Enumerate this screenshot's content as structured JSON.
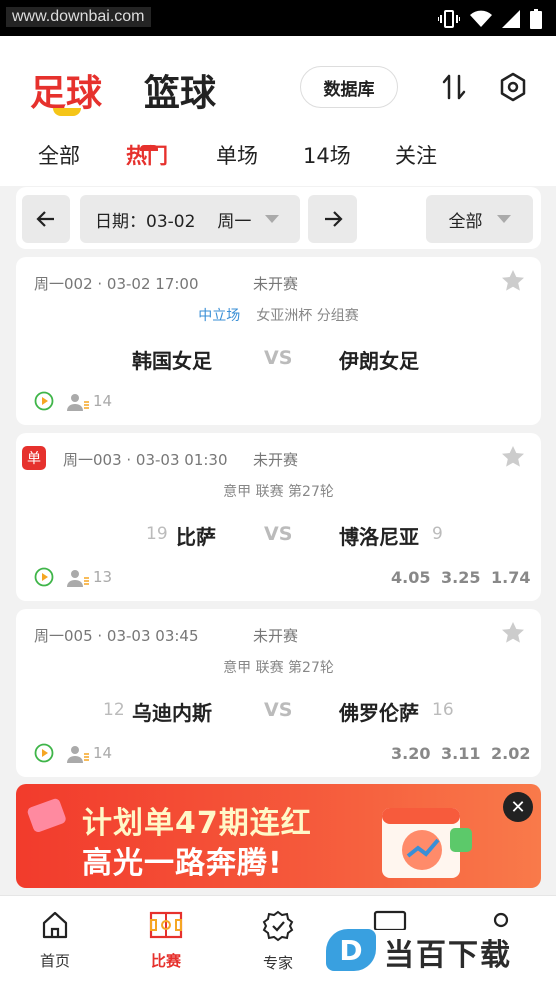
{
  "statusbar": {
    "watermark": "www.downbai.com",
    "time_hint": "3"
  },
  "header": {
    "sport_tabs": [
      {
        "label": "足球",
        "active": true
      },
      {
        "label": "篮球",
        "active": false
      }
    ],
    "database_label": "数据库"
  },
  "tabs": [
    {
      "label": "全部",
      "active": false
    },
    {
      "label": "热门",
      "active": true
    },
    {
      "label": "单场",
      "active": false
    },
    {
      "label": "14场",
      "active": false
    },
    {
      "label": "关注",
      "active": false
    }
  ],
  "filter": {
    "date_label": "日期：03-02",
    "weekday": "周一",
    "scope": "全部"
  },
  "matches": [
    {
      "id": "周一002 · 03-02 17:00",
      "status": "未开赛",
      "neutral": "中立场",
      "league": "女亚洲杯 分组赛",
      "home": "韩国女足",
      "home_rank": "",
      "away": "伊朗女足",
      "away_rank": "",
      "vs": "VS",
      "count": "14",
      "odds": [],
      "dan": ""
    },
    {
      "id": "周一003 · 03-03 01:30",
      "status": "未开赛",
      "neutral": "",
      "league": "意甲 联赛 第27轮",
      "home": "比萨",
      "home_rank": "19",
      "away": "博洛尼亚",
      "away_rank": "9",
      "vs": "VS",
      "count": "13",
      "odds": [
        "4.05",
        "3.25",
        "1.74"
      ],
      "dan": "单"
    },
    {
      "id": "周一005 · 03-03 03:45",
      "status": "未开赛",
      "neutral": "",
      "league": "意甲 联赛 第27轮",
      "home": "乌迪内斯",
      "home_rank": "12",
      "away": "佛罗伦萨",
      "away_rank": "16",
      "vs": "VS",
      "count": "14",
      "odds": [
        "3.20",
        "3.11",
        "2.02"
      ],
      "dan": ""
    }
  ],
  "banner": {
    "line1": "计划单47期连红",
    "line2": "高光一路奔腾!",
    "close": "✕"
  },
  "bottom_nav": [
    {
      "label": "首页",
      "icon": "home-icon",
      "active": false
    },
    {
      "label": "比赛",
      "icon": "pitch-icon",
      "active": true
    },
    {
      "label": "专家",
      "icon": "badge-check-icon",
      "active": false
    }
  ],
  "watermark": {
    "logo": "D",
    "text": "当百下载"
  },
  "colors": {
    "accent": "#e6312d",
    "yellow": "#f5c518",
    "neutral_blue": "#3a8fd6",
    "play_green": "#3fb549"
  }
}
